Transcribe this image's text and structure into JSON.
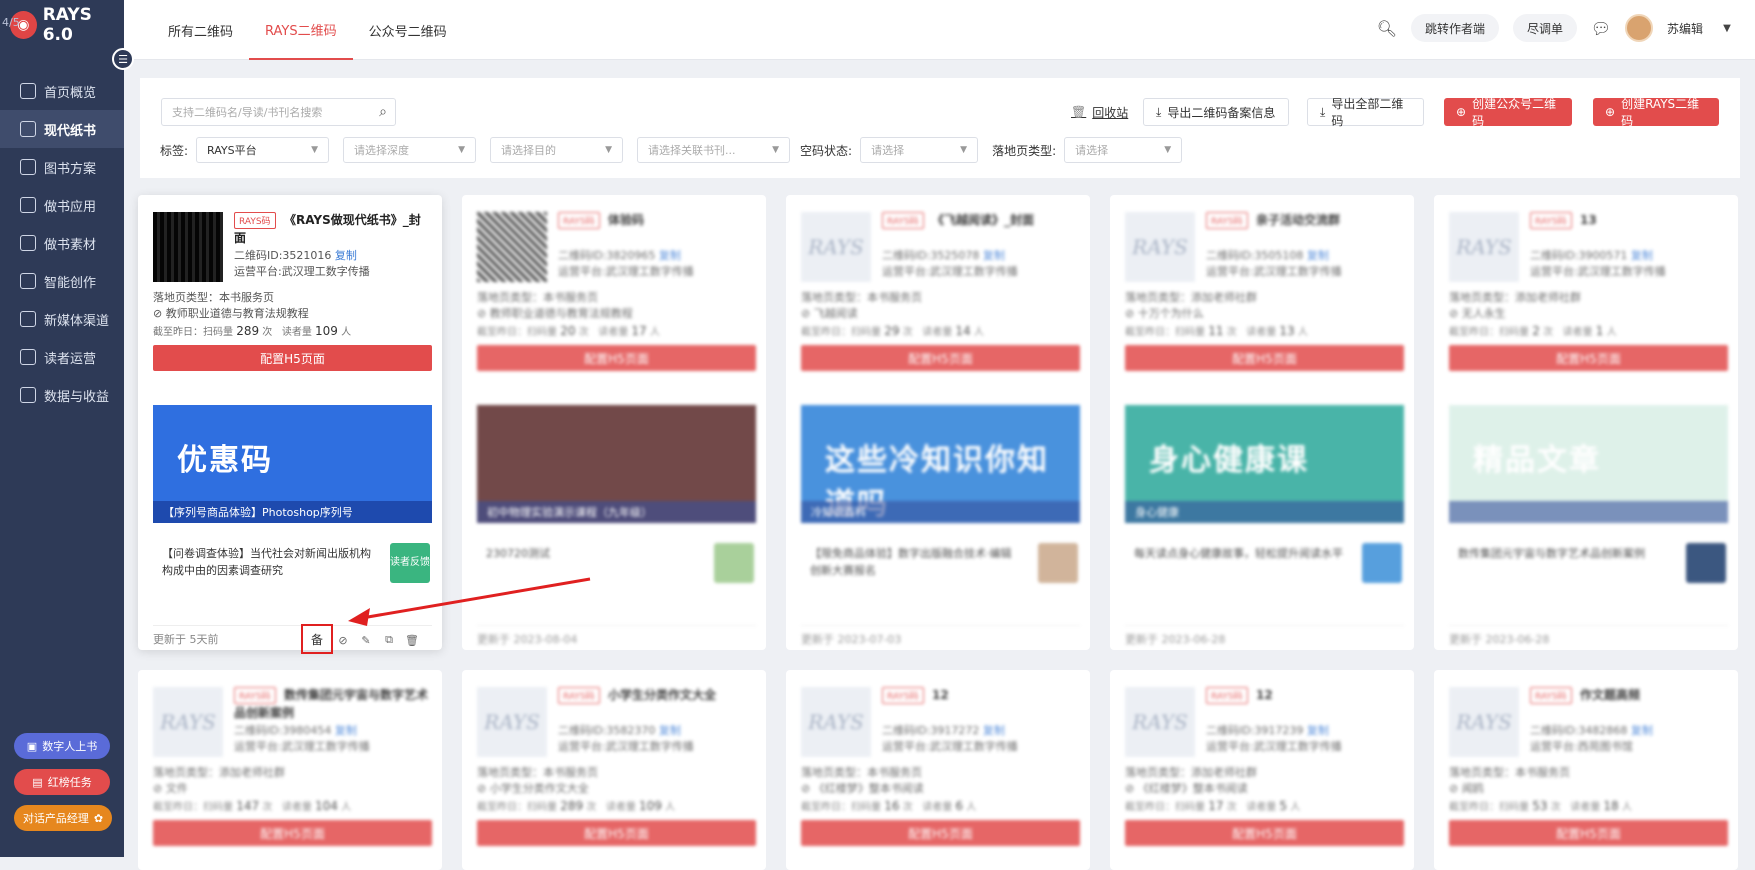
{
  "app": {
    "corner_text": "4/5",
    "brand": "RAYS 6.0"
  },
  "sidebar": {
    "items": [
      {
        "label": "首页概览"
      },
      {
        "label": "现代纸书"
      },
      {
        "label": "图书方案"
      },
      {
        "label": "做书应用"
      },
      {
        "label": "做书素材"
      },
      {
        "label": "智能创作"
      },
      {
        "label": "新媒体渠道"
      },
      {
        "label": "读者运营"
      },
      {
        "label": "数据与收益"
      }
    ],
    "active_index": 1,
    "bottom_buttons": [
      "数字人上书",
      "红榜任务",
      "对话产品经理"
    ]
  },
  "header": {
    "tabs": [
      "所有二维码",
      "RAYS二维码",
      "公众号二维码"
    ],
    "active_tab": 1,
    "pills": [
      "跳转作者端",
      "尽调单"
    ],
    "user_name": "苏编辑"
  },
  "toolbar": {
    "search_placeholder": "支持二维码名/导读/书刊名搜索",
    "recycle": "回收站",
    "export_record": "导出二维码备案信息",
    "export_all": "导出全部二维码",
    "create_official": "创建公众号二维码",
    "create_rays": "创建RAYS二维码"
  },
  "filters": {
    "tag_label": "标签:",
    "tag_value": "RAYS平台",
    "depth_placeholder": "请选择深度",
    "purpose_placeholder": "请选择目的",
    "book_placeholder": "请选择关联书刊...",
    "empty_label": "空码状态:",
    "empty_placeholder": "请选择",
    "landing_label": "落地页类型:",
    "landing_placeholder": "请选择"
  },
  "cards": [
    {
      "tag": "RAYS码",
      "title": "《RAYS做现代纸书》_封面",
      "id_label": "二维码ID:",
      "id": "3521016",
      "copy": "复制",
      "platform_label": "运营平台:",
      "platform": "武汉理工数字传播",
      "landing": "落地页类型：本书服务页",
      "book": "教师职业道德与教育法规教程",
      "stats_prefix": "截至昨日：扫码量",
      "scans": "289",
      "scans_unit": "次",
      "readers_label": "读者量",
      "readers": "109",
      "readers_unit": "人",
      "config": "配置H5页面",
      "banner_title": "优惠码",
      "banner_sub": "【序列号商品体验】Photoshop序列号",
      "desc": "【问卷调查体验】当代社会对新闻出版机构构成中由的因素调查研究",
      "thumb_label": "读者反馈",
      "updated": "更新于 5天前",
      "banner_color": "#2f6fe0",
      "thumb_color": "#3ab580"
    },
    {
      "tag": "RAYS码",
      "title": "体验码",
      "id_label": "二维码ID:",
      "id": "3820965",
      "copy": "复制",
      "platform_label": "运营平台:",
      "platform": "武汉理工数字传播",
      "landing": "落地页类型：本书服务页",
      "book": "教师职业道德与教育法规教程",
      "stats_prefix": "截至昨日：扫码量",
      "scans": "20",
      "scans_unit": "次",
      "readers_label": "读者量",
      "readers": "17",
      "readers_unit": "人",
      "config": "配置H5页面",
      "banner_title": "",
      "banner_sub": "初中物理实验演示课程（九年级）",
      "desc": "230720测试",
      "thumb_label": "",
      "updated": "更新于 2023-08-04",
      "banner_color": "#5a2a2a",
      "thumb_color": "#9bc88a"
    },
    {
      "tag": "RAYS码",
      "title": "《飞越阅读》_封面",
      "id_label": "二维码ID:",
      "id": "3525078",
      "copy": "复制",
      "platform_label": "运营平台:",
      "platform": "武汉理工数字传播",
      "landing": "落地页类型：本书服务页",
      "book": "飞越阅读",
      "stats_prefix": "截至昨日：扫码量",
      "scans": "29",
      "scans_unit": "次",
      "readers_label": "读者量",
      "readers": "14",
      "readers_unit": "人",
      "config": "配置H5页面",
      "banner_title": "这些冷知识你知道吗",
      "banner_sub": "冷知识百科",
      "desc": "【限免商品体验】数字出版融合技术·编辑创新大赛报名",
      "thumb_label": "",
      "updated": "更新于 2023-07-03",
      "banner_color": "#2a7fd8",
      "thumb_color": "#c9a88a"
    },
    {
      "tag": "RAYS码",
      "title": "亲子活动交流群",
      "id_label": "二维码ID:",
      "id": "3505108",
      "copy": "复制",
      "platform_label": "运营平台:",
      "platform": "武汉理工数字传播",
      "landing": "落地页类型：添加老师社群",
      "book": "十万个为什么",
      "stats_prefix": "截至昨日：扫码量",
      "scans": "11",
      "scans_unit": "次",
      "readers_label": "读者量",
      "readers": "13",
      "readers_unit": "人",
      "config": "配置H5页面",
      "banner_title": "身心健康课",
      "banner_sub": "身心健康",
      "desc": "每天读点身心健康故事，轻松提升阅读水平",
      "thumb_label": "",
      "updated": "更新于 2023-06-28",
      "banner_color": "#2aa89a",
      "thumb_color": "#3a8fd8"
    },
    {
      "tag": "RAYS码",
      "title": "13",
      "id_label": "二维码ID:",
      "id": "3900571",
      "copy": "复制",
      "platform_label": "运营平台:",
      "platform": "武汉理工数字传播",
      "landing": "落地页类型：添加老师社群",
      "book": "无人永生",
      "stats_prefix": "截至昨日：扫码量",
      "scans": "2",
      "scans_unit": "次",
      "readers_label": "读者量",
      "readers": "1",
      "readers_unit": "人",
      "config": "配置H5页面",
      "banner_title": "精品文章",
      "banner_sub": "",
      "desc": "数传集团元宇宙与数字艺术品创新案例",
      "thumb_label": "",
      "updated": "更新于 2023-06-28",
      "banner_color": "#d9efe6",
      "thumb_color": "#1a3a6a"
    },
    {
      "tag": "RAYS码",
      "title": "数传集团元宇宙与数字艺术品创新案例",
      "id_label": "二维码ID:",
      "id": "3980454",
      "copy": "复制",
      "platform_label": "运营平台:",
      "platform": "武汉理工数字传播",
      "landing": "落地页类型：添加老师社群",
      "book": "文件",
      "stats_prefix": "截至昨日：扫码量",
      "scans": "147",
      "scans_unit": "次",
      "readers_label": "读者量",
      "readers": "104",
      "readers_unit": "人",
      "config": "配置H5页面"
    },
    {
      "tag": "RAYS码",
      "title": "小学生分类作文大全",
      "id_label": "二维码ID:",
      "id": "3582370",
      "copy": "复制",
      "platform_label": "运营平台:",
      "platform": "武汉理工数字传播",
      "landing": "落地页类型：本书服务页",
      "book": "小学生分类作文大全",
      "stats_prefix": "截至昨日：扫码量",
      "scans": "289",
      "scans_unit": "次",
      "readers_label": "读者量",
      "readers": "109",
      "readers_unit": "人",
      "config": "配置H5页面"
    },
    {
      "tag": "RAYS码",
      "title": "12",
      "id_label": "二维码ID:",
      "id": "3917272",
      "copy": "复制",
      "platform_label": "运营平台:",
      "platform": "武汉理工数字传播",
      "landing": "落地页类型：本书服务页",
      "book": "《红楼梦》整本书阅读",
      "stats_prefix": "截至昨日：扫码量",
      "scans": "16",
      "scans_unit": "次",
      "readers_label": "读者量",
      "readers": "6",
      "readers_unit": "人",
      "config": "配置H5页面"
    },
    {
      "tag": "RAYS码",
      "title": "12",
      "id_label": "二维码ID:",
      "id": "3917239",
      "copy": "复制",
      "platform_label": "运营平台:",
      "platform": "武汉理工数字传播",
      "landing": "落地页类型：添加老师社群",
      "book": "《红楼梦》整本书阅读",
      "stats_prefix": "截至昨日：扫码量",
      "scans": "17",
      "scans_unit": "次",
      "readers_label": "读者量",
      "readers": "5",
      "readers_unit": "人",
      "config": "配置H5页面"
    },
    {
      "tag": "RAYS码",
      "title": "作文题高频",
      "id_label": "二维码ID:",
      "id": "3482868",
      "copy": "复制",
      "platform_label": "运营平台:",
      "platform": "西苑图书馆",
      "landing": "落地页类型：本书服务页",
      "book": "闻鸥",
      "stats_prefix": "截至昨日：扫码量",
      "scans": "53",
      "scans_unit": "次",
      "readers_label": "读者量",
      "readers": "18",
      "readers_unit": "人",
      "config": "配置H5页面"
    }
  ],
  "footer_icons": {
    "record": "备"
  }
}
